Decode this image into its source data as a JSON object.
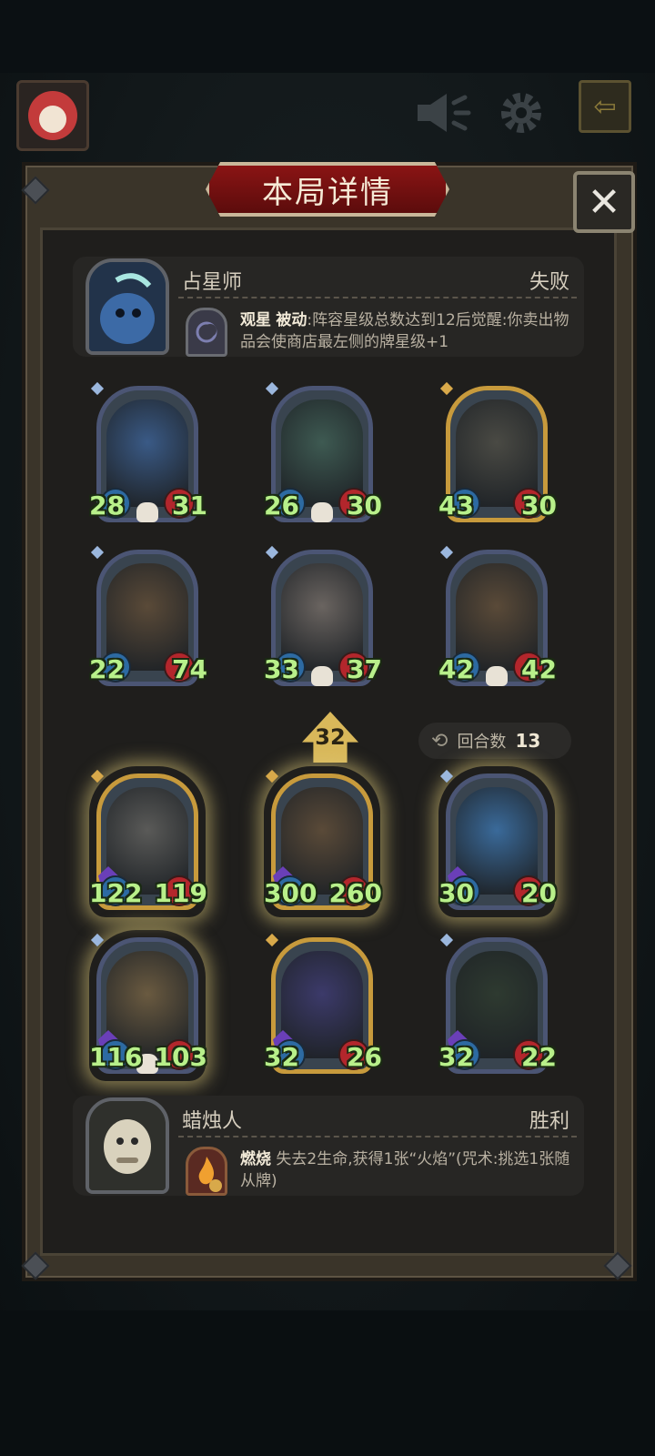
{
  "title": "本局详情",
  "close_label": "✕",
  "top_bar": {
    "volume_icon": "speaker-icon",
    "settings_icon": "gear-icon",
    "back_icon": "back-arrow-icon"
  },
  "turn_counter": {
    "label": "回合数",
    "value": "13"
  },
  "level": "32",
  "opponent": {
    "name": "占星师",
    "result": "失败",
    "skill_name": "观星",
    "skill_type": "被动",
    "skill_desc": ":阵容星级总数达到12后觉醒:你卖出物品会使商店最左侧的牌星级+1"
  },
  "opponent_units": [
    {
      "atk": "28",
      "hp": "31",
      "tier": "blue",
      "art_color": "#3a5a86",
      "skull": true
    },
    {
      "atk": "26",
      "hp": "30",
      "tier": "blue",
      "art_color": "#3e5a52",
      "skull": true
    },
    {
      "atk": "43",
      "hp": "30",
      "tier": "gold",
      "art_color": "#4a4a44",
      "skull": false
    },
    {
      "atk": "22",
      "hp": "74",
      "tier": "blue",
      "art_color": "#5a4a38",
      "skull": false
    },
    {
      "atk": "33",
      "hp": "37",
      "tier": "blue",
      "art_color": "#6a6460",
      "skull": true
    },
    {
      "atk": "42",
      "hp": "42",
      "tier": "blue",
      "art_color": "#5a4a38",
      "skull": true
    }
  ],
  "player_units": [
    {
      "atk": "122",
      "hp": "119",
      "tier": "gold",
      "art_color": "#5a5a58",
      "skull": false
    },
    {
      "atk": "300",
      "hp": "260",
      "tier": "gold",
      "art_color": "#5a4a38",
      "skull": false
    },
    {
      "atk": "30",
      "hp": "20",
      "tier": "blue",
      "art_color": "#3a6a9a",
      "skull": false
    },
    {
      "atk": "116",
      "hp": "103",
      "tier": "blue",
      "art_color": "#6a5a40",
      "skull": true
    },
    {
      "atk": "32",
      "hp": "26",
      "tier": "gold",
      "art_color": "#3c3a6a",
      "skull": false
    },
    {
      "atk": "32",
      "hp": "22",
      "tier": "blue",
      "art_color": "#2e3a30",
      "skull": false
    }
  ],
  "player": {
    "name": "蜡烛人",
    "result": "胜利",
    "skill_name": "燃烧",
    "skill_desc": "失去2生命,获得1张“火焰”(咒术:挑选1张随从牌)"
  }
}
